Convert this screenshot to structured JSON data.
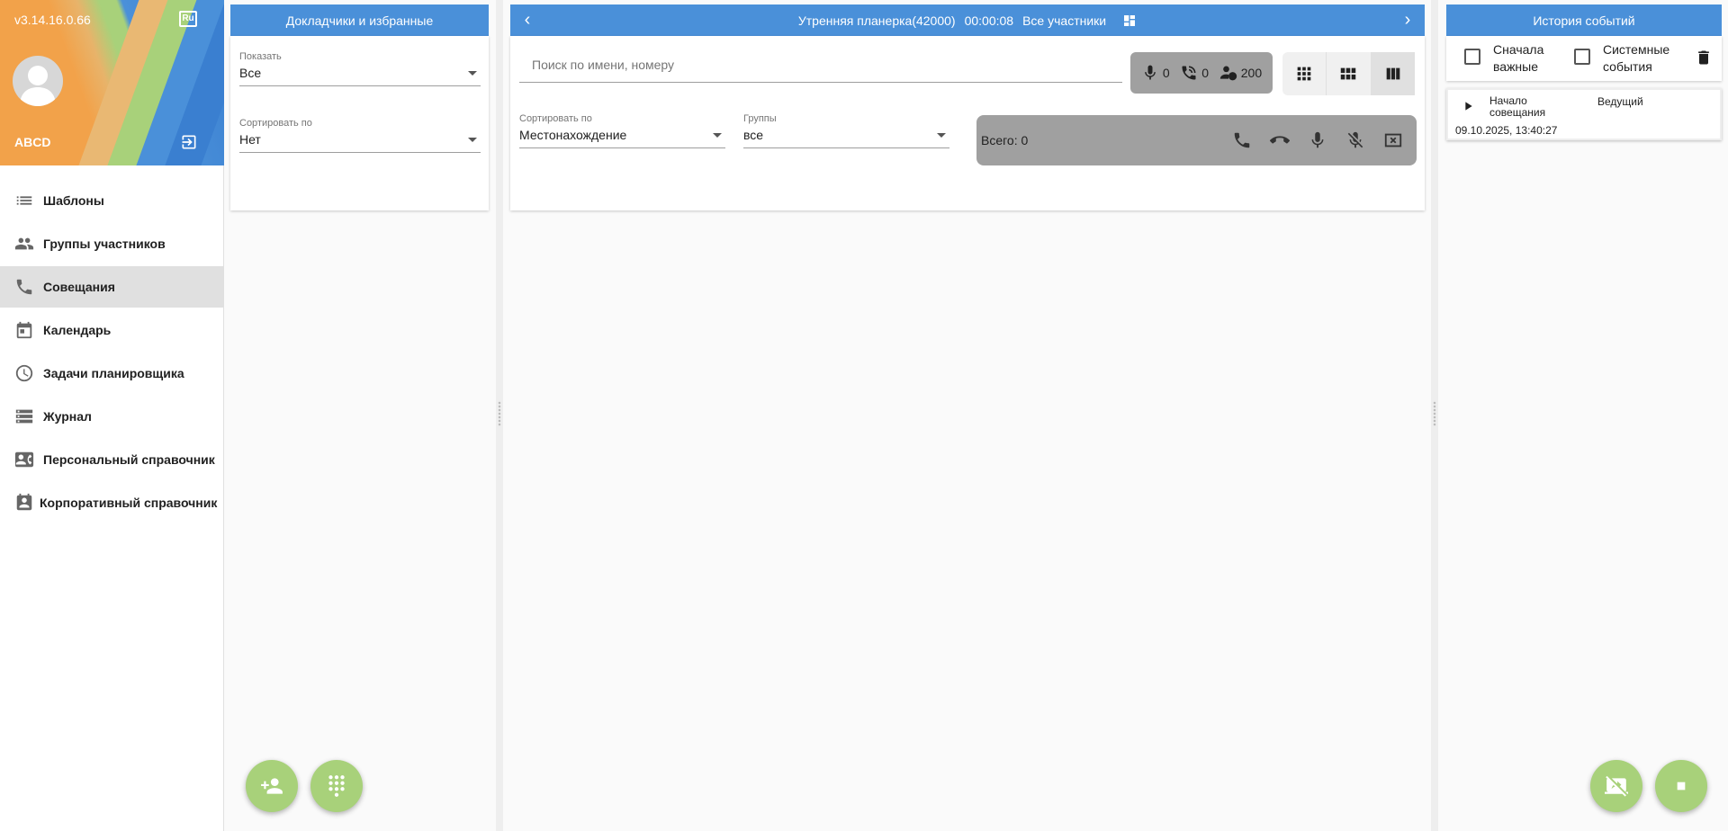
{
  "nav": {
    "version": "v3.14.16.0.66",
    "lang_icon_text": "Ru",
    "user_name": "ABCD",
    "items": [
      {
        "label": "Шаблоны",
        "icon": "list-icon"
      },
      {
        "label": "Группы участников",
        "icon": "people-icon"
      },
      {
        "label": "Совещания",
        "icon": "phone-icon"
      },
      {
        "label": "Календарь",
        "icon": "calendar-icon"
      },
      {
        "label": "Задачи планировщика",
        "icon": "clock-icon"
      },
      {
        "label": "Журнал",
        "icon": "storage-list-icon"
      },
      {
        "label": "Персональный справочник",
        "icon": "contact-card-icon"
      },
      {
        "label": "Корпоративный справочник",
        "icon": "contact-book-icon"
      }
    ],
    "active_index": 2
  },
  "speakers": {
    "title": "Докладчики и избранные",
    "show_label": "Показать",
    "show_value": "Все",
    "sort_label": "Сортировать по",
    "sort_value": "Нет"
  },
  "main": {
    "conference_title": "Утренняя планерка(42000)",
    "timer": "00:00:08",
    "participants_filter": "Все участники",
    "search_placeholder": "Поиск по имени, номеру",
    "counters": {
      "speaking": "0",
      "calls": "0",
      "max": "200"
    },
    "sort_label": "Сортировать по",
    "sort_value": "Местонахождение",
    "groups_label": "Группы",
    "groups_value": "все",
    "total": "Всего: 0"
  },
  "events": {
    "title": "История событий",
    "important_first": "Сначала важные",
    "system_events": "Системные события",
    "item": {
      "name": "Начало совещания",
      "role": "Ведущий",
      "timestamp": "09.10.2025, 13:40:27"
    }
  },
  "colors": {
    "header_blue": "#4a90d9",
    "fab_green": "#a8d17a",
    "counter_gray": "#a0a0a0"
  }
}
